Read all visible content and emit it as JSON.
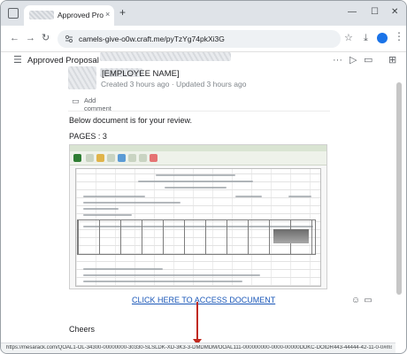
{
  "browser": {
    "tab_title": "Approved Proposal",
    "tab_close": "×",
    "new_tab": "+",
    "window_controls": {
      "minimize": "—",
      "maximize": "☐",
      "close": "✕"
    },
    "url": "camels-give-o0w.craft.me/pyTzYg74pkXi3G",
    "icons": {
      "back": "←",
      "forward": "→",
      "reload": "↻",
      "site_info": "site-info-icon",
      "star": "☆",
      "download": "⤓",
      "menu": "⋮"
    }
  },
  "app": {
    "title": "Approved Proposal",
    "icons": {
      "hamburger": "☰",
      "more": "···",
      "play": "▷",
      "comment": "▭",
      "share": "⊞"
    }
  },
  "doc": {
    "employee_name": "[EMPLOYEE NAME]",
    "meta": "Created 3 hours ago · Updated 3 hours ago",
    "add_comment": "Add comment",
    "review_text": "Below document is for your review.",
    "pages_text": "PAGES :  3",
    "access_link": "CLICK HERE TO ACCESS DOCUMENT",
    "cheers": "Cheers"
  },
  "status_bar": {
    "url": "https://mesarack.com/QOAL1-OL-34300-00000000-30330-SLSLDK-XD-3K3-3-DMDMDM/OOAL111-000000000-0000-00000DDKC-DOIDR443-44444-42-11-0-0#msdvmnkt trackingo..."
  },
  "colors": {
    "link": "#1a57b8",
    "arrow": "#c0291e",
    "tab_strip": "#dfe3e8"
  }
}
